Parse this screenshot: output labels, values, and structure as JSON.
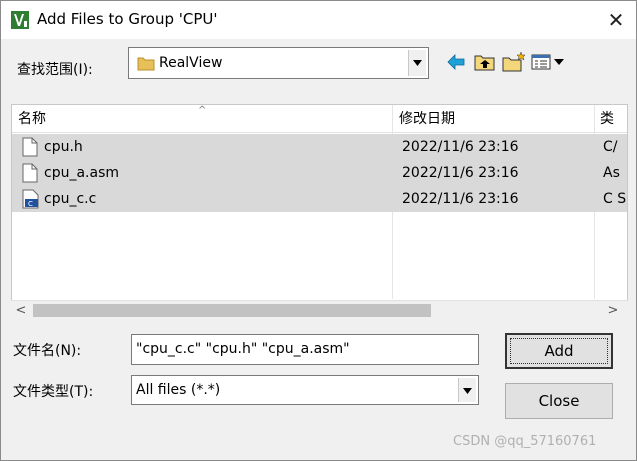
{
  "window": {
    "title": "Add Files to Group 'CPU'",
    "close_glyph": "✕"
  },
  "lookin": {
    "label": "查找范围(I):",
    "value": "RealView"
  },
  "toolbar": {
    "icons": [
      "back-arrow-icon",
      "up-folder-icon",
      "new-folder-icon",
      "view-menu-icon"
    ]
  },
  "file_list": {
    "columns": [
      "名称",
      "修改日期",
      "类"
    ],
    "sort_glyph": "^",
    "rows": [
      {
        "name": "cpu.h",
        "date": "2022/11/6 23:16",
        "type": "C/",
        "icon": "document-icon"
      },
      {
        "name": "cpu_a.asm",
        "date": "2022/11/6 23:16",
        "type": "As",
        "icon": "document-icon"
      },
      {
        "name": "cpu_c.c",
        "date": "2022/11/6 23:16",
        "type": "C S",
        "icon": "c-source-icon"
      }
    ]
  },
  "scrollbar": {
    "left_glyph": "<",
    "right_glyph": ">"
  },
  "filename": {
    "label": "文件名(N):",
    "value": "\"cpu_c.c\" \"cpu.h\" \"cpu_a.asm\""
  },
  "filetype": {
    "label": "文件类型(T):",
    "value": "All files (*.*)"
  },
  "buttons": {
    "add": "Add",
    "close": "Close"
  },
  "watermark": "CSDN @qq_57160761",
  "colors": {
    "selection": "#d9d9d9",
    "folder": "#e8c05a",
    "nav_arrow": "#1fa0d8"
  }
}
